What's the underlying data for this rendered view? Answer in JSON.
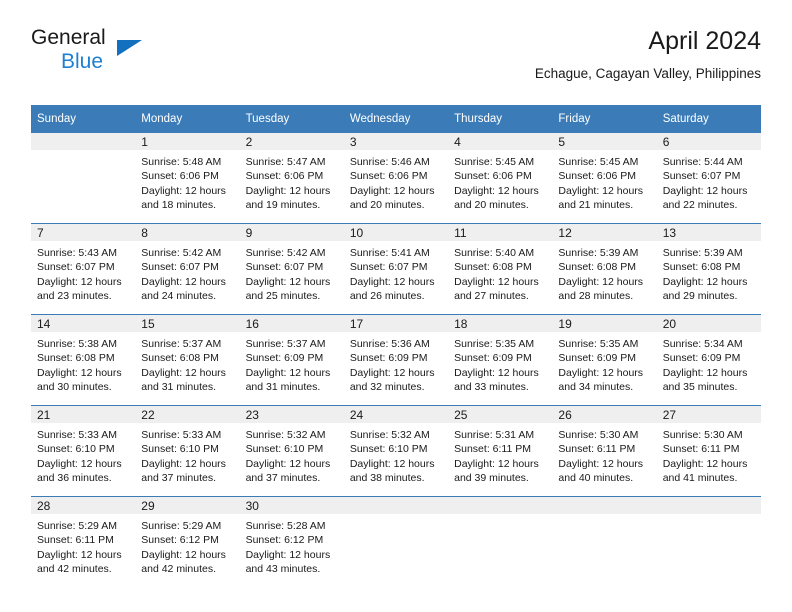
{
  "brand": {
    "name_part1": "General",
    "name_part2": "Blue",
    "triangle_icon": "blue-triangle-logo-icon",
    "accent_color": "#1f7fd0"
  },
  "header": {
    "title": "April 2024",
    "subtitle": "Echague, Cagayan Valley, Philippines"
  },
  "theme": {
    "header_bg": "#3b7cb8",
    "header_text": "#ffffff",
    "daynum_bg": "#efefef",
    "divider": "#3b7cb8"
  },
  "weekday_headers": [
    "Sunday",
    "Monday",
    "Tuesday",
    "Wednesday",
    "Thursday",
    "Friday",
    "Saturday"
  ],
  "weeks": [
    {
      "days": [
        {
          "date": "",
          "sunrise": "",
          "sunset": "",
          "daylight_line1": "",
          "daylight_line2": "",
          "blank": true
        },
        {
          "date": "1",
          "sunrise": "Sunrise: 5:48 AM",
          "sunset": "Sunset: 6:06 PM",
          "daylight_line1": "Daylight: 12 hours",
          "daylight_line2": "and 18 minutes."
        },
        {
          "date": "2",
          "sunrise": "Sunrise: 5:47 AM",
          "sunset": "Sunset: 6:06 PM",
          "daylight_line1": "Daylight: 12 hours",
          "daylight_line2": "and 19 minutes."
        },
        {
          "date": "3",
          "sunrise": "Sunrise: 5:46 AM",
          "sunset": "Sunset: 6:06 PM",
          "daylight_line1": "Daylight: 12 hours",
          "daylight_line2": "and 20 minutes."
        },
        {
          "date": "4",
          "sunrise": "Sunrise: 5:45 AM",
          "sunset": "Sunset: 6:06 PM",
          "daylight_line1": "Daylight: 12 hours",
          "daylight_line2": "and 20 minutes."
        },
        {
          "date": "5",
          "sunrise": "Sunrise: 5:45 AM",
          "sunset": "Sunset: 6:06 PM",
          "daylight_line1": "Daylight: 12 hours",
          "daylight_line2": "and 21 minutes."
        },
        {
          "date": "6",
          "sunrise": "Sunrise: 5:44 AM",
          "sunset": "Sunset: 6:07 PM",
          "daylight_line1": "Daylight: 12 hours",
          "daylight_line2": "and 22 minutes."
        }
      ]
    },
    {
      "days": [
        {
          "date": "7",
          "sunrise": "Sunrise: 5:43 AM",
          "sunset": "Sunset: 6:07 PM",
          "daylight_line1": "Daylight: 12 hours",
          "daylight_line2": "and 23 minutes."
        },
        {
          "date": "8",
          "sunrise": "Sunrise: 5:42 AM",
          "sunset": "Sunset: 6:07 PM",
          "daylight_line1": "Daylight: 12 hours",
          "daylight_line2": "and 24 minutes."
        },
        {
          "date": "9",
          "sunrise": "Sunrise: 5:42 AM",
          "sunset": "Sunset: 6:07 PM",
          "daylight_line1": "Daylight: 12 hours",
          "daylight_line2": "and 25 minutes."
        },
        {
          "date": "10",
          "sunrise": "Sunrise: 5:41 AM",
          "sunset": "Sunset: 6:07 PM",
          "daylight_line1": "Daylight: 12 hours",
          "daylight_line2": "and 26 minutes."
        },
        {
          "date": "11",
          "sunrise": "Sunrise: 5:40 AM",
          "sunset": "Sunset: 6:08 PM",
          "daylight_line1": "Daylight: 12 hours",
          "daylight_line2": "and 27 minutes."
        },
        {
          "date": "12",
          "sunrise": "Sunrise: 5:39 AM",
          "sunset": "Sunset: 6:08 PM",
          "daylight_line1": "Daylight: 12 hours",
          "daylight_line2": "and 28 minutes."
        },
        {
          "date": "13",
          "sunrise": "Sunrise: 5:39 AM",
          "sunset": "Sunset: 6:08 PM",
          "daylight_line1": "Daylight: 12 hours",
          "daylight_line2": "and 29 minutes."
        }
      ]
    },
    {
      "days": [
        {
          "date": "14",
          "sunrise": "Sunrise: 5:38 AM",
          "sunset": "Sunset: 6:08 PM",
          "daylight_line1": "Daylight: 12 hours",
          "daylight_line2": "and 30 minutes."
        },
        {
          "date": "15",
          "sunrise": "Sunrise: 5:37 AM",
          "sunset": "Sunset: 6:08 PM",
          "daylight_line1": "Daylight: 12 hours",
          "daylight_line2": "and 31 minutes."
        },
        {
          "date": "16",
          "sunrise": "Sunrise: 5:37 AM",
          "sunset": "Sunset: 6:09 PM",
          "daylight_line1": "Daylight: 12 hours",
          "daylight_line2": "and 31 minutes."
        },
        {
          "date": "17",
          "sunrise": "Sunrise: 5:36 AM",
          "sunset": "Sunset: 6:09 PM",
          "daylight_line1": "Daylight: 12 hours",
          "daylight_line2": "and 32 minutes."
        },
        {
          "date": "18",
          "sunrise": "Sunrise: 5:35 AM",
          "sunset": "Sunset: 6:09 PM",
          "daylight_line1": "Daylight: 12 hours",
          "daylight_line2": "and 33 minutes."
        },
        {
          "date": "19",
          "sunrise": "Sunrise: 5:35 AM",
          "sunset": "Sunset: 6:09 PM",
          "daylight_line1": "Daylight: 12 hours",
          "daylight_line2": "and 34 minutes."
        },
        {
          "date": "20",
          "sunrise": "Sunrise: 5:34 AM",
          "sunset": "Sunset: 6:09 PM",
          "daylight_line1": "Daylight: 12 hours",
          "daylight_line2": "and 35 minutes."
        }
      ]
    },
    {
      "days": [
        {
          "date": "21",
          "sunrise": "Sunrise: 5:33 AM",
          "sunset": "Sunset: 6:10 PM",
          "daylight_line1": "Daylight: 12 hours",
          "daylight_line2": "and 36 minutes."
        },
        {
          "date": "22",
          "sunrise": "Sunrise: 5:33 AM",
          "sunset": "Sunset: 6:10 PM",
          "daylight_line1": "Daylight: 12 hours",
          "daylight_line2": "and 37 minutes."
        },
        {
          "date": "23",
          "sunrise": "Sunrise: 5:32 AM",
          "sunset": "Sunset: 6:10 PM",
          "daylight_line1": "Daylight: 12 hours",
          "daylight_line2": "and 37 minutes."
        },
        {
          "date": "24",
          "sunrise": "Sunrise: 5:32 AM",
          "sunset": "Sunset: 6:10 PM",
          "daylight_line1": "Daylight: 12 hours",
          "daylight_line2": "and 38 minutes."
        },
        {
          "date": "25",
          "sunrise": "Sunrise: 5:31 AM",
          "sunset": "Sunset: 6:11 PM",
          "daylight_line1": "Daylight: 12 hours",
          "daylight_line2": "and 39 minutes."
        },
        {
          "date": "26",
          "sunrise": "Sunrise: 5:30 AM",
          "sunset": "Sunset: 6:11 PM",
          "daylight_line1": "Daylight: 12 hours",
          "daylight_line2": "and 40 minutes."
        },
        {
          "date": "27",
          "sunrise": "Sunrise: 5:30 AM",
          "sunset": "Sunset: 6:11 PM",
          "daylight_line1": "Daylight: 12 hours",
          "daylight_line2": "and 41 minutes."
        }
      ]
    },
    {
      "days": [
        {
          "date": "28",
          "sunrise": "Sunrise: 5:29 AM",
          "sunset": "Sunset: 6:11 PM",
          "daylight_line1": "Daylight: 12 hours",
          "daylight_line2": "and 42 minutes."
        },
        {
          "date": "29",
          "sunrise": "Sunrise: 5:29 AM",
          "sunset": "Sunset: 6:12 PM",
          "daylight_line1": "Daylight: 12 hours",
          "daylight_line2": "and 42 minutes."
        },
        {
          "date": "30",
          "sunrise": "Sunrise: 5:28 AM",
          "sunset": "Sunset: 6:12 PM",
          "daylight_line1": "Daylight: 12 hours",
          "daylight_line2": "and 43 minutes."
        },
        {
          "date": "",
          "sunrise": "",
          "sunset": "",
          "daylight_line1": "",
          "daylight_line2": "",
          "blank": true
        },
        {
          "date": "",
          "sunrise": "",
          "sunset": "",
          "daylight_line1": "",
          "daylight_line2": "",
          "blank": true
        },
        {
          "date": "",
          "sunrise": "",
          "sunset": "",
          "daylight_line1": "",
          "daylight_line2": "",
          "blank": true
        },
        {
          "date": "",
          "sunrise": "",
          "sunset": "",
          "daylight_line1": "",
          "daylight_line2": "",
          "blank": true
        }
      ]
    }
  ]
}
